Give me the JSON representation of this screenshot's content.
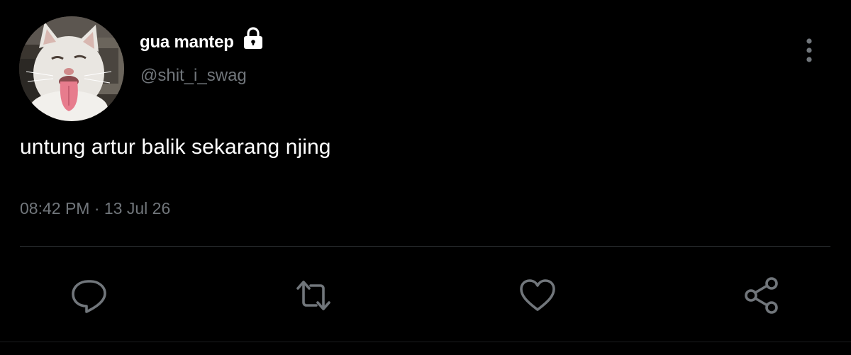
{
  "user": {
    "display_name": "gua mantep",
    "handle": "@shit_i_swag",
    "avatar": "cat-sticking-out-tongue-photo",
    "protected_icon": "lock-icon"
  },
  "tweet": {
    "text": "untung artur balik sekarang njing",
    "meta": "08:42 PM · 13 Jul 26"
  },
  "actions": {
    "reply_icon": "reply-icon",
    "retweet_icon": "retweet-icon",
    "like_icon": "heart-icon",
    "share_icon": "share-icon",
    "more_icon": "more-vertical-icon"
  },
  "colors": {
    "background": "#000000",
    "primary_text": "#ffffff",
    "secondary_text": "#71767b",
    "icon": "#71767b",
    "divider": "#2f3336"
  }
}
